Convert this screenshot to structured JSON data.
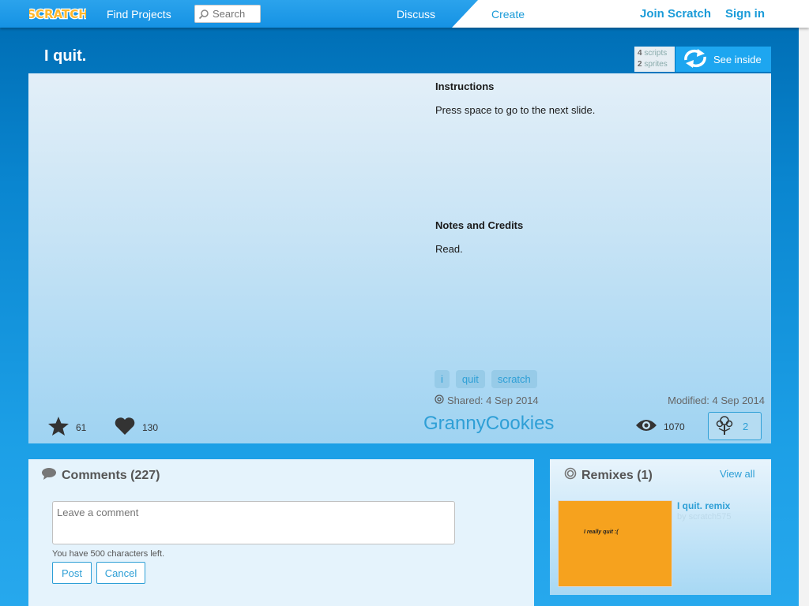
{
  "nav": {
    "logo_text": "SCRATCH",
    "find_projects": "Find Projects",
    "search_placeholder": "Search",
    "discuss": "Discuss",
    "create": "Create",
    "join": "Join Scratch",
    "signin": "Sign in"
  },
  "project": {
    "title": "I quit.",
    "scripts_count": "4",
    "scripts_label": "scripts",
    "sprites_count": "2",
    "sprites_label": "sprites",
    "see_inside": "See inside",
    "instructions_heading": "Instructions",
    "instructions_text": "Press space to go to the next slide.",
    "notes_heading": "Notes and Credits",
    "notes_text": "Read.",
    "tags": [
      "i",
      "quit",
      "scratch"
    ],
    "shared": "Shared: 4 Sep 2014",
    "modified": "Modified: 4 Sep 2014",
    "favorites": "61",
    "loves": "130",
    "author": "GrannyCookies",
    "views": "1070",
    "remix_count": "2"
  },
  "comments": {
    "title": "Comments (227)",
    "placeholder": "Leave a comment",
    "chars_left": "You have 500 characters left.",
    "post": "Post",
    "cancel": "Cancel"
  },
  "remixes": {
    "title": "Remixes (1)",
    "view_all": "View all",
    "items": [
      {
        "name": "I quit. remix",
        "by": "by scratch575",
        "thumb_text": "I really quit :("
      }
    ]
  },
  "colors": {
    "accent": "#2e9fd6",
    "nav_blue": "#1592e4",
    "thumb_orange": "#f6a21e"
  }
}
